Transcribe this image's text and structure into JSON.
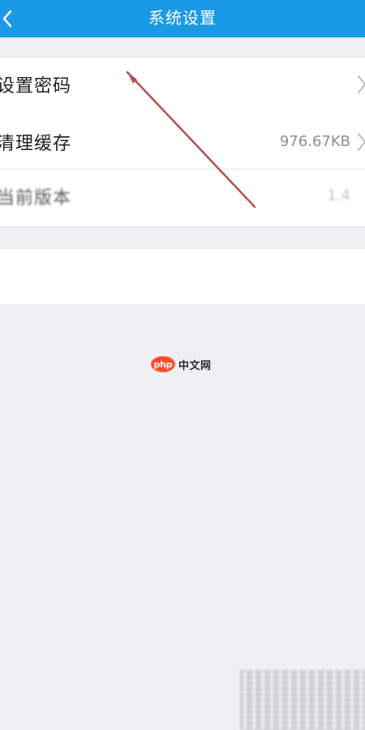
{
  "header": {
    "title": "系统设置",
    "back_icon": "chevron-left-icon"
  },
  "settings": {
    "rows": [
      {
        "label": "设置密码",
        "value": "",
        "chevron_icon": "chevron-right-icon"
      },
      {
        "label": "清理缓存",
        "value": "976.67KB",
        "chevron_icon": "chevron-right-icon"
      },
      {
        "label": "当前版本",
        "value": "1.4",
        "chevron_icon": ""
      }
    ]
  },
  "watermark": {
    "brand": "php",
    "text": "中文网"
  },
  "colors": {
    "header_bg": "#1a9ae6",
    "page_bg": "#efeff4",
    "annotation": "#b5504f",
    "logout_text": "#2b9be2"
  }
}
